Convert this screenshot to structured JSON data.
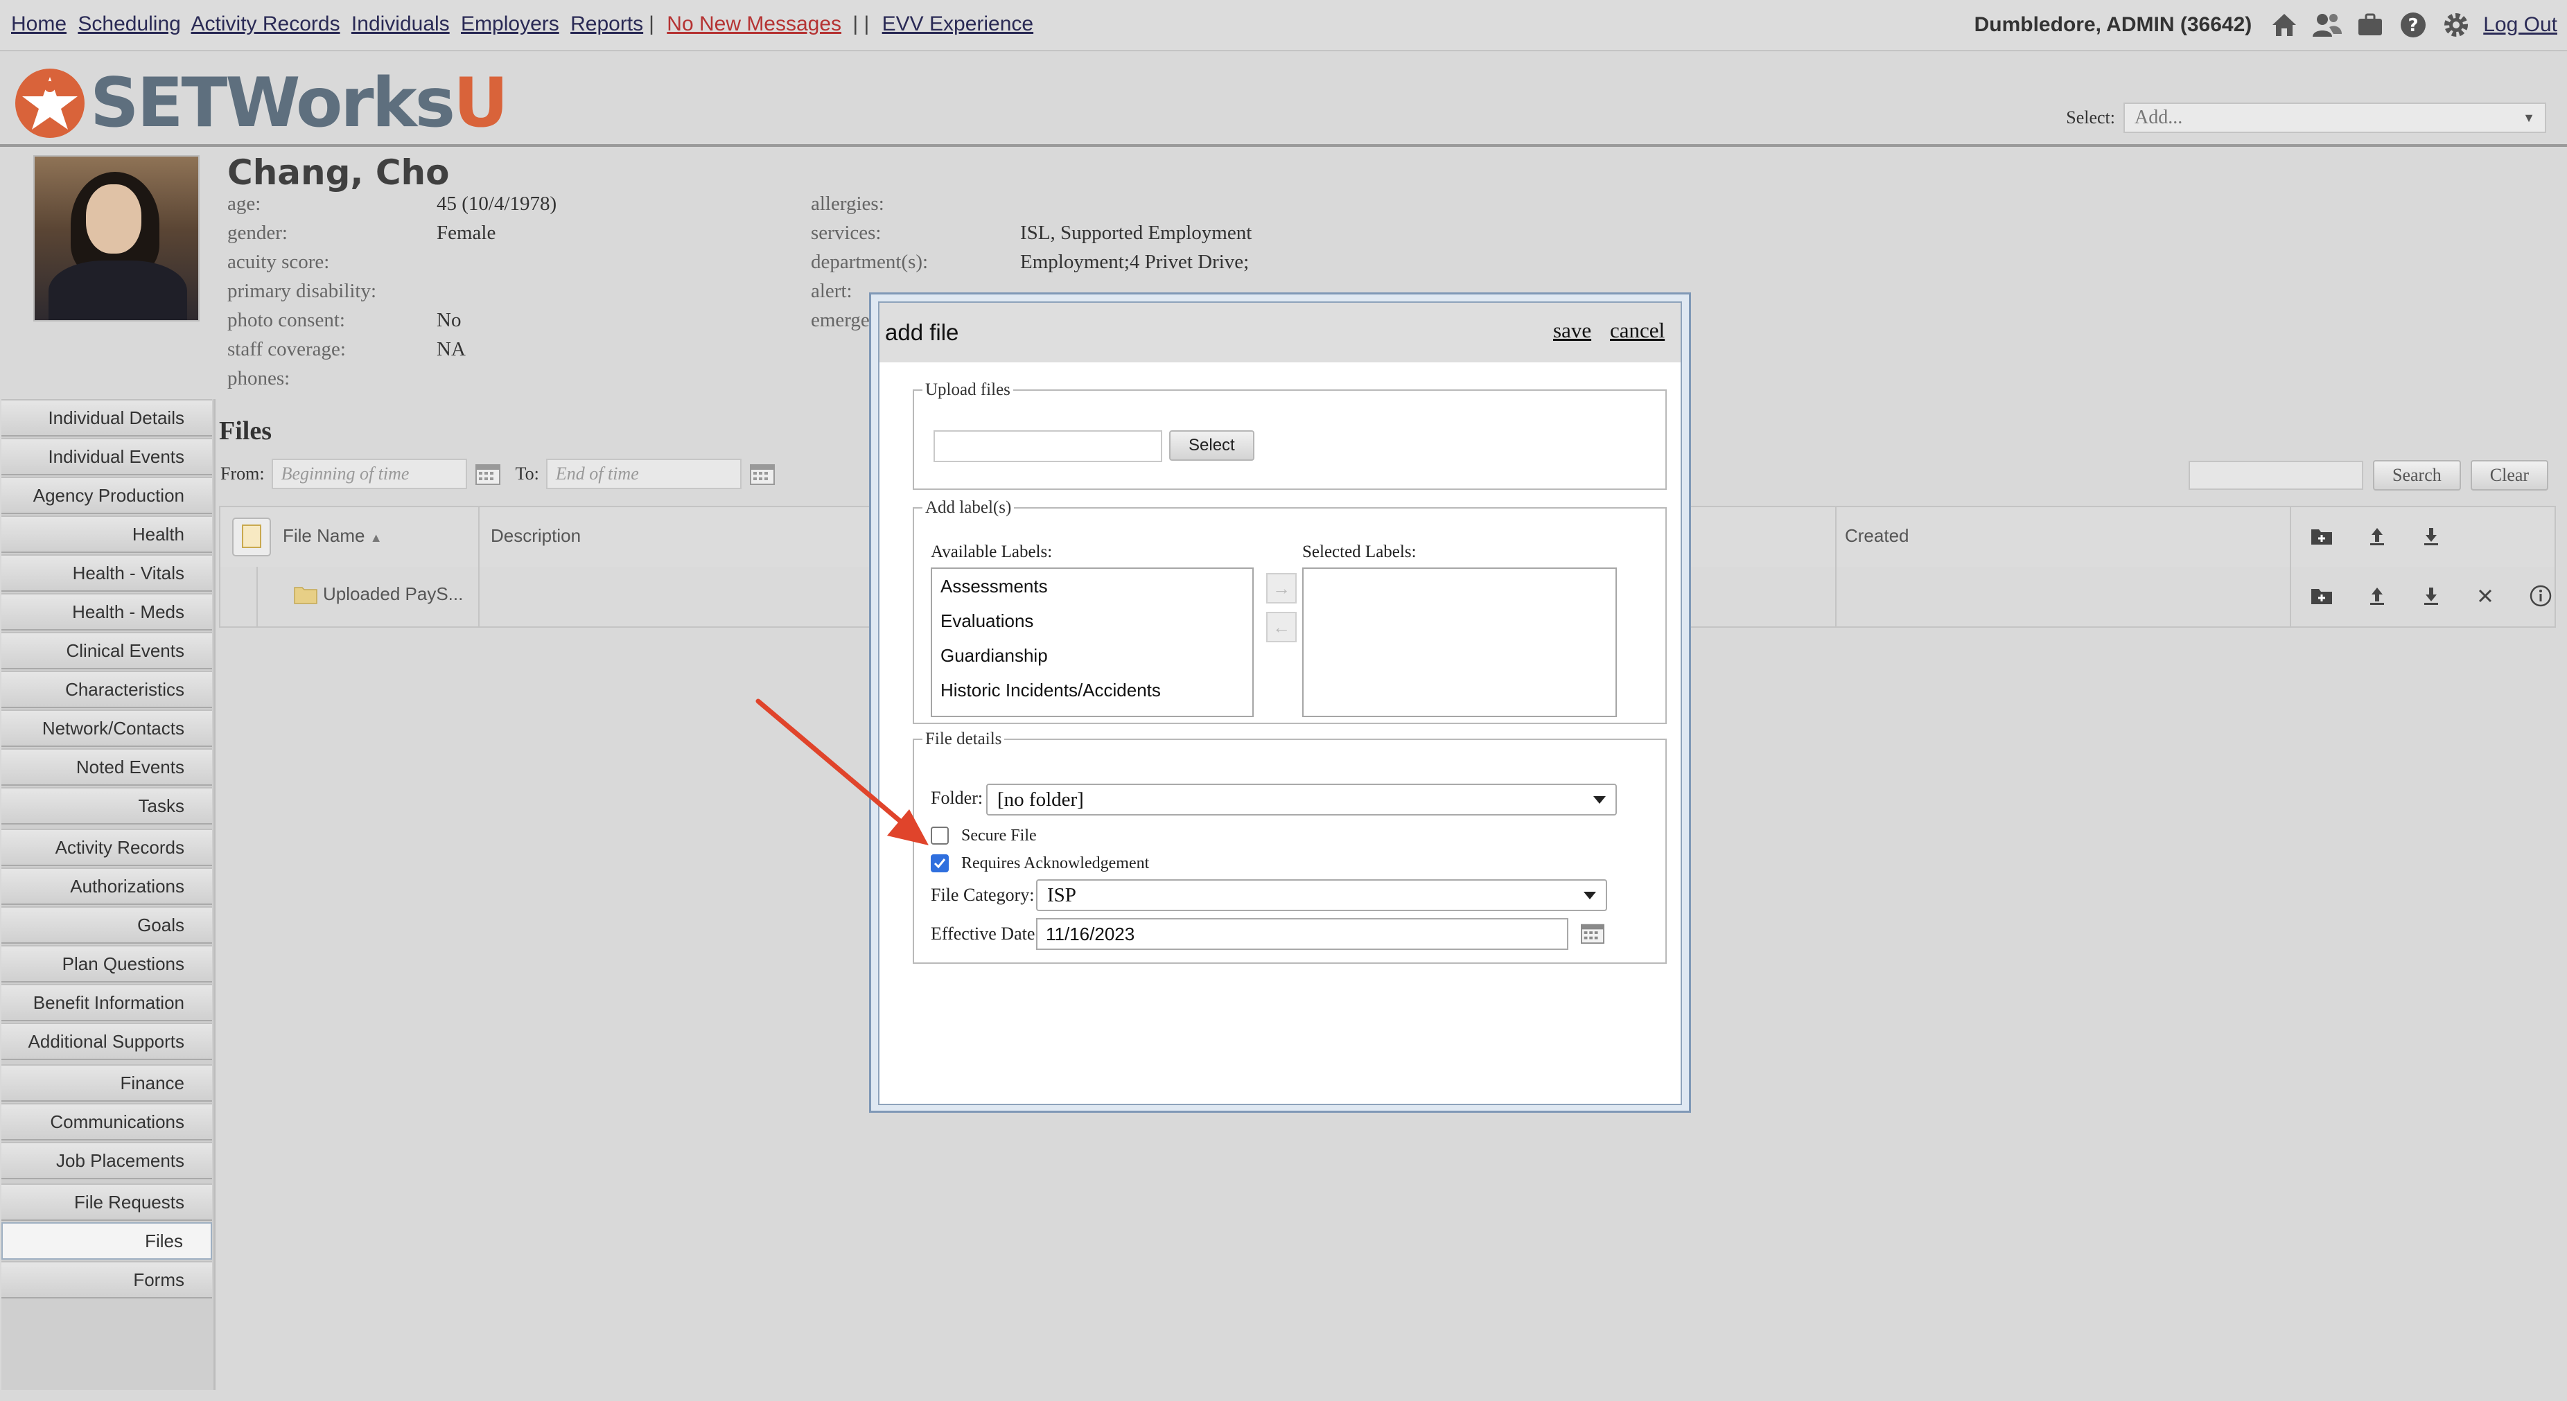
{
  "nav": {
    "links": [
      "Home",
      "Scheduling",
      "Activity Records",
      "Individuals",
      "Employers",
      "Reports"
    ],
    "messages": "No New Messages",
    "separator": "| |",
    "evv": "EVV Experience",
    "user": "Dumbledore, ADMIN (36642)",
    "logout": "Log Out",
    "icons": [
      "home-icon",
      "people-icon",
      "briefcase-icon",
      "help-icon",
      "gear-icon"
    ]
  },
  "brand": {
    "text": "SETWorks",
    "u": "U"
  },
  "header_select": {
    "label": "Select:",
    "value": "Add..."
  },
  "profile": {
    "name": "Chang, Cho",
    "left_fields": [
      {
        "label": "age:",
        "value": "45 (10/4/1978)"
      },
      {
        "label": "gender:",
        "value": "Female"
      },
      {
        "label": "acuity score:",
        "value": ""
      },
      {
        "label": "primary disability:",
        "value": ""
      },
      {
        "label": "photo consent:",
        "value": "No"
      },
      {
        "label": "staff coverage:",
        "value": "NA"
      },
      {
        "label": "phones:",
        "value": ""
      }
    ],
    "right_fields": [
      {
        "label": "allergies:",
        "value": ""
      },
      {
        "label": "services:",
        "value": "ISL, Supported Employment"
      },
      {
        "label": "department(s):",
        "value": "Employment;4 Privet Drive;"
      },
      {
        "label": "alert:",
        "value": ""
      },
      {
        "label": "emerge",
        "value": ""
      }
    ]
  },
  "sidebar": {
    "items": [
      "Individual Details",
      "Individual Events",
      "Agency Production",
      "Health",
      "Health - Vitals",
      "Health - Meds",
      "Clinical Events",
      "Characteristics",
      "Network/Contacts",
      "Noted Events",
      "Tasks",
      "Activity Records",
      "Authorizations",
      "Goals",
      "Plan Questions",
      "Benefit Information",
      "Additional Supports",
      "Finance",
      "Communications",
      "Job Placements",
      "File Requests",
      "Files",
      "Forms"
    ],
    "active": "Files"
  },
  "files": {
    "title": "Files",
    "from_label": "From:",
    "from_placeholder": "Beginning of time",
    "to_label": "To:",
    "to_placeholder": "End of time",
    "search_label": "Search",
    "clear_label": "Clear",
    "columns": [
      "File Name",
      "Description",
      "Created"
    ],
    "rows": [
      {
        "name": "Uploaded PayS..."
      }
    ]
  },
  "modal": {
    "title": "add file",
    "save": "save",
    "cancel": "cancel",
    "upload_legend": "Upload files",
    "select_button": "Select",
    "labels_legend": "Add label(s)",
    "available_labels_title": "Available Labels:",
    "available_labels": [
      "Assessments",
      "Evaluations",
      "Guardianship",
      "Historic Incidents/Accidents"
    ],
    "selected_labels_title": "Selected Labels:",
    "details_legend": "File details",
    "folder_label": "Folder:",
    "folder_value": "[no folder]",
    "secure_file_label": "Secure File",
    "secure_file_checked": false,
    "requires_ack_label": "Requires Acknowledgement",
    "requires_ack_checked": true,
    "category_label": "File Category:",
    "category_value": "ISP",
    "effective_date_label": "Effective Date",
    "effective_date_value": "11/16/2023"
  },
  "colors": {
    "annotation_arrow": "#e0442b",
    "checkbox_on": "#2f6fde",
    "brand_gray": "#5e6f7e",
    "brand_orange": "#d9633a"
  }
}
